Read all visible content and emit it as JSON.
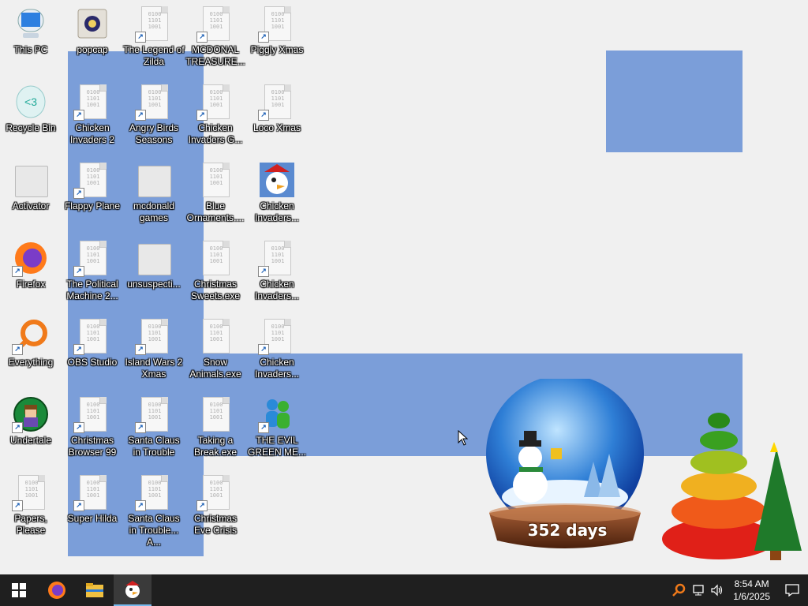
{
  "desktop": {
    "icons": [
      {
        "label": "This PC",
        "type": "thispc"
      },
      {
        "label": "Recycle Bin",
        "type": "recycle"
      },
      {
        "label": "Activator",
        "type": "folder"
      },
      {
        "label": "Firefox",
        "type": "firefox"
      },
      {
        "label": "Everything",
        "type": "everything"
      },
      {
        "label": "Undertale",
        "type": "undertale"
      },
      {
        "label": "Papers, Please",
        "type": "doc"
      },
      {
        "label": "popcap",
        "type": "popcap"
      },
      {
        "label": "Chicken Invaders 2",
        "type": "doc"
      },
      {
        "label": "Flappy Plane",
        "type": "doc"
      },
      {
        "label": "The Political Machine 2...",
        "type": "doc"
      },
      {
        "label": "OBS Studio",
        "type": "doc"
      },
      {
        "label": "Christmas Browser 99",
        "type": "doc"
      },
      {
        "label": "Super Hilda",
        "type": "doc"
      },
      {
        "label": "The Legend of Zilda",
        "type": "doc"
      },
      {
        "label": "Angry Birds Seasons",
        "type": "doc"
      },
      {
        "label": "mcdonald games",
        "type": "folder"
      },
      {
        "label": "unsuspecti...",
        "type": "folder"
      },
      {
        "label": "Island Wars 2 Xmas",
        "type": "doc"
      },
      {
        "label": "Santa Claus in Trouble",
        "type": "doc"
      },
      {
        "label": "Santa Claus in Trouble... A...",
        "type": "doc"
      },
      {
        "label": "MCDONAL TREASURE...",
        "type": "doc"
      },
      {
        "label": "Chicken Invaders G...",
        "type": "doc"
      },
      {
        "label": "Blue Ornaments....",
        "type": "doc"
      },
      {
        "label": "Christmas Sweets.exe",
        "type": "doc"
      },
      {
        "label": "Snow Animals.exe",
        "type": "doc"
      },
      {
        "label": "Taking a Break.exe",
        "type": "doc"
      },
      {
        "label": "Christmas Eve Crisis",
        "type": "doc"
      },
      {
        "label": "Piggly Xmas",
        "type": "doc"
      },
      {
        "label": "Loco Xmas",
        "type": "doc"
      },
      {
        "label": "Chicken Invaders...",
        "type": "chicken"
      },
      {
        "label": "Chicken Invaders...",
        "type": "doc"
      },
      {
        "label": "Chicken Invaders...",
        "type": "doc"
      },
      {
        "label": "THE EVIL GREEN ME...",
        "type": "messenger"
      }
    ],
    "countdown": "352 days"
  },
  "taskbar": {
    "start": "start-icon",
    "pinned": [
      "firefox-icon",
      "file-explorer-icon",
      "chicken-invaders-icon"
    ],
    "tray": [
      "everything-icon",
      "network-icon",
      "volume-icon"
    ],
    "time": "8:54 AM",
    "date": "1/6/2025",
    "notification": "notification-icon"
  },
  "colors": {
    "accent": "#7b9ed9",
    "taskbar": "#1f1f1f",
    "desktop": "#f0f0f0"
  }
}
